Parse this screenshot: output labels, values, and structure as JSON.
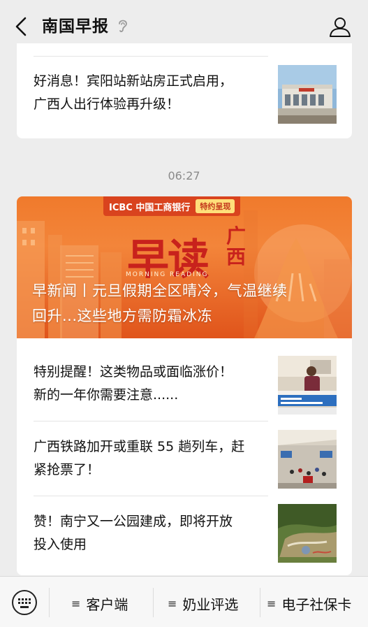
{
  "header": {
    "title": "南国早报"
  },
  "articles_top": [
    {
      "title_line1": "好消息！宾阳站新站房正式启用，",
      "title_line2": "广西人出行体验再升级！"
    }
  ],
  "timestamp": "06:27",
  "feature": {
    "sponsor": "ICBC 中国工商银行",
    "sponsor_badge": "特约呈现",
    "banner_big": "早读",
    "banner_side": "广西",
    "banner_eng": "MORNING READING",
    "title_line1": "早新闻丨元旦假期全区晴冷，气温继续",
    "title_line2": "回升...这些地方需防霜冰冻"
  },
  "articles": [
    {
      "title_line1": "特别提醒！这类物品或面临涨价！",
      "title_line2": "新的一年你需要注意......"
    },
    {
      "title_line1": "广西铁路加开或重联 55 趟列车，赶",
      "title_line2": "紧抢票了！"
    },
    {
      "title_line1": "赞！南宁又一公园建成，即将开放",
      "title_line2": "投入使用"
    }
  ],
  "bottom_menu": [
    {
      "label": "客户端"
    },
    {
      "label": "奶业评选"
    },
    {
      "label": "电子社保卡"
    }
  ],
  "colors": {
    "accent_orange": "#f07a2c",
    "brand_red": "#c8221c"
  }
}
